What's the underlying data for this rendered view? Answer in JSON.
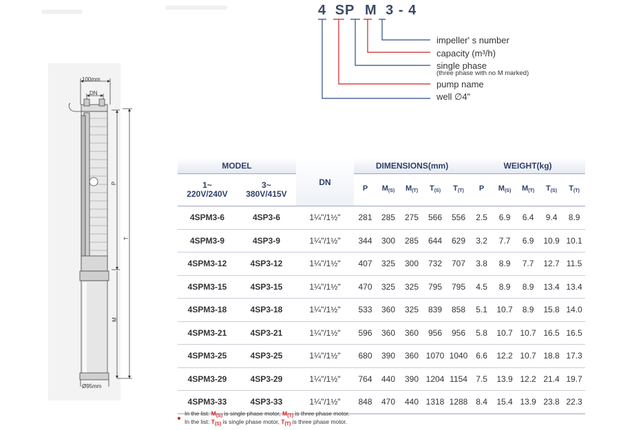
{
  "model_code": {
    "parts": [
      "4",
      "SP",
      "M",
      "3",
      "-",
      "4"
    ],
    "legend": [
      {
        "text": "impeller' s number",
        "color": "#2b4a86"
      },
      {
        "text": "capacity (m³/h)",
        "color": "#cc2222"
      },
      {
        "text": "single phase",
        "sub": "(three phase with no M marked)",
        "color": "#2b4a86"
      },
      {
        "text": "pump name",
        "color": "#cc2222"
      },
      {
        "text": "well ∅4\"",
        "color": "#2b4a86"
      }
    ]
  },
  "drawing": {
    "width_top": "100mm",
    "dn": "DN",
    "p": "P",
    "t": "T",
    "m": "M",
    "width_bottom": "Ø95mm"
  },
  "table": {
    "group_headers": {
      "model": "MODEL",
      "dn": "DN",
      "dimensions": "DIMENSIONS(mm)",
      "weight": "WEIGHT(kg)"
    },
    "model_sub": [
      {
        "line1": "1~",
        "line2": "220V/240V"
      },
      {
        "line1": "3~",
        "line2": "380V/415V"
      }
    ],
    "dim_cols": [
      {
        "main": "P",
        "sub": ""
      },
      {
        "main": "M",
        "sub": "(S)"
      },
      {
        "main": "M",
        "sub": "(T)"
      },
      {
        "main": "T",
        "sub": "(S)"
      },
      {
        "main": "T",
        "sub": "(T)"
      }
    ],
    "weight_cols": [
      {
        "main": "P",
        "sub": ""
      },
      {
        "main": "M",
        "sub": "(S)"
      },
      {
        "main": "M",
        "sub": "(T)"
      },
      {
        "main": "T",
        "sub": "(S)"
      },
      {
        "main": "T",
        "sub": "(T)"
      }
    ],
    "rows": [
      {
        "m1": "4SPM3-6",
        "m3": "4SP3-6",
        "dn": "1¼\"/1½\"",
        "d": [
          "281",
          "285",
          "275",
          "566",
          "556"
        ],
        "w": [
          "2.5",
          "6.9",
          "6.4",
          "9.4",
          "8.9"
        ]
      },
      {
        "m1": "4SPM3-9",
        "m3": "4SP3-9",
        "dn": "1¼\"/1½\"",
        "d": [
          "344",
          "300",
          "285",
          "644",
          "629"
        ],
        "w": [
          "3.2",
          "7.7",
          "6.9",
          "10.9",
          "10.1"
        ]
      },
      {
        "m1": "4SPM3-12",
        "m3": "4SP3-12",
        "dn": "1¼\"/1½\"",
        "d": [
          "407",
          "325",
          "300",
          "732",
          "707"
        ],
        "w": [
          "3.8",
          "8.9",
          "7.7",
          "12.7",
          "11.5"
        ]
      },
      {
        "m1": "4SPM3-15",
        "m3": "4SP3-15",
        "dn": "1¼\"/1½\"",
        "d": [
          "470",
          "325",
          "325",
          "795",
          "795"
        ],
        "w": [
          "4.5",
          "8.9",
          "8.9",
          "13.4",
          "13.4"
        ]
      },
      {
        "m1": "4SPM3-18",
        "m3": "4SP3-18",
        "dn": "1¼\"/1½\"",
        "d": [
          "533",
          "360",
          "325",
          "839",
          "858"
        ],
        "w": [
          "5.1",
          "10.7",
          "8.9",
          "15.8",
          "14.0"
        ]
      },
      {
        "m1": "4SPM3-21",
        "m3": "4SP3-21",
        "dn": "1¼\"/1½\"",
        "d": [
          "596",
          "360",
          "360",
          "956",
          "956"
        ],
        "w": [
          "5.8",
          "10.7",
          "10.7",
          "16.5",
          "16.5"
        ]
      },
      {
        "m1": "4SPM3-25",
        "m3": "4SP3-25",
        "dn": "1¼\"/1½\"",
        "d": [
          "680",
          "390",
          "360",
          "1070",
          "1040"
        ],
        "w": [
          "6.6",
          "12.2",
          "10.7",
          "18.8",
          "17.3"
        ]
      },
      {
        "m1": "4SPM3-29",
        "m3": "4SP3-29",
        "dn": "1¼\"/1½\"",
        "d": [
          "764",
          "440",
          "390",
          "1204",
          "1154"
        ],
        "w": [
          "7.5",
          "13.9",
          "12.2",
          "21.4",
          "19.7"
        ]
      },
      {
        "m1": "4SPM3-33",
        "m3": "4SP3-33",
        "dn": "1¼\"/1½\"",
        "d": [
          "848",
          "470",
          "440",
          "1318",
          "1288"
        ],
        "w": [
          "8.4",
          "15.4",
          "13.9",
          "23.8",
          "22.3"
        ]
      }
    ]
  },
  "notes": [
    {
      "prefix": "In the list: ",
      "k1": "M",
      "k1sub": "(S)",
      "mid": " is single phase motor, ",
      "k2": "M",
      "k2sub": "(T)",
      "suffix": " is three phase motor."
    },
    {
      "prefix": "In the list: ",
      "k1": "T",
      "k1sub": "(S)",
      "mid": " is single phase motor, ",
      "k2": "T",
      "k2sub": "(T)",
      "suffix": " is three phase motor."
    }
  ]
}
